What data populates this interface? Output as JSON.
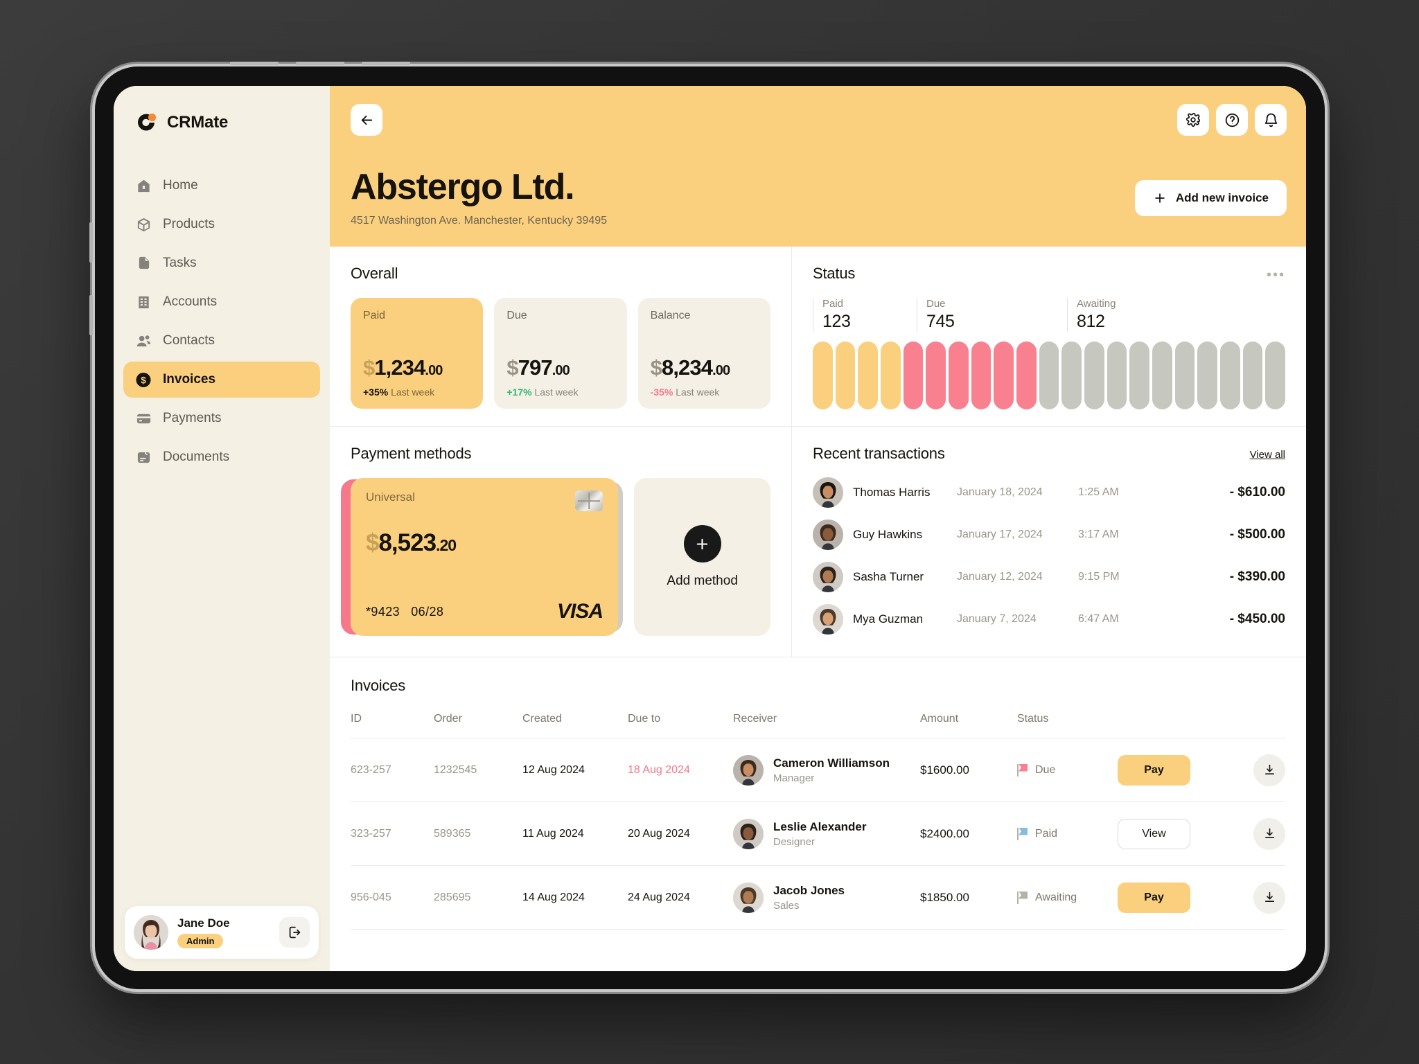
{
  "brand": {
    "name": "CRMate"
  },
  "sidebar": {
    "items": [
      {
        "label": "Home",
        "icon": "home-icon",
        "active": false
      },
      {
        "label": "Products",
        "icon": "box-icon",
        "active": false
      },
      {
        "label": "Tasks",
        "icon": "file-icon",
        "active": false
      },
      {
        "label": "Accounts",
        "icon": "building-icon",
        "active": false
      },
      {
        "label": "Contacts",
        "icon": "users-icon",
        "active": false
      },
      {
        "label": "Invoices",
        "icon": "dollar-circle-icon",
        "active": true
      },
      {
        "label": "Payments",
        "icon": "credit-card-icon",
        "active": false
      },
      {
        "label": "Documents",
        "icon": "document-icon",
        "active": false
      }
    ],
    "user": {
      "name": "Jane Doe",
      "role": "Admin",
      "logout_icon": "logout-icon"
    }
  },
  "header": {
    "back_icon": "arrow-left-icon",
    "settings_icon": "gear-icon",
    "help_icon": "question-circle-icon",
    "notifications_icon": "bell-icon",
    "title": "Abstergo Ltd.",
    "address": "4517 Washington Ave. Manchester, Kentucky 39495",
    "add_invoice_label": "Add new invoice",
    "accent": "#fad07f"
  },
  "overall": {
    "title": "Overall",
    "stats": [
      {
        "label": "Paid",
        "currency": "$",
        "value": "1,234",
        "cents": ".00",
        "delta": "+35%",
        "delta_note": "Last week",
        "trend": "up"
      },
      {
        "label": "Due",
        "currency": "$",
        "value": "797",
        "cents": ".00",
        "delta": "+17%",
        "delta_note": "Last week",
        "trend": "up"
      },
      {
        "label": "Balance",
        "currency": "$",
        "value": "8,234",
        "cents": ".00",
        "delta": "-35%",
        "delta_note": "Last week",
        "trend": "down"
      }
    ]
  },
  "chart_data": {
    "type": "bar",
    "title": "Status",
    "categories": [
      "Paid",
      "Due",
      "Awaiting"
    ],
    "values": [
      123,
      745,
      812
    ],
    "series": [
      {
        "name": "Paid",
        "value": 123,
        "color": "#fad07f",
        "bars": 4
      },
      {
        "name": "Due",
        "value": 745,
        "color": "#f9808f",
        "bars": 6
      },
      {
        "name": "Awaiting",
        "value": 812,
        "color": "#c6c7bf",
        "bars": 11
      }
    ],
    "xlabel": "",
    "ylabel": "",
    "grid": false,
    "legend": "top",
    "menu_icon": "more-horizontal-icon"
  },
  "payment_methods": {
    "title": "Payment methods",
    "card": {
      "label": "Universal",
      "currency": "$",
      "amount": "8,523",
      "cents": ".20",
      "number": "*9423",
      "expiry": "06/28",
      "network": "VISA",
      "chip_icon": "chip-icon"
    },
    "add_method_label": "Add method",
    "add_icon": "plus-icon"
  },
  "transactions": {
    "title": "Recent transactions",
    "view_all_label": "View all",
    "rows": [
      {
        "name": "Thomas Harris",
        "date": "January 18, 2024",
        "time": "1:25 AM",
        "amount": "- $610.00"
      },
      {
        "name": "Guy Hawkins",
        "date": "January 17, 2024",
        "time": "3:17 AM",
        "amount": "- $500.00"
      },
      {
        "name": "Sasha Turner",
        "date": "January 12, 2024",
        "time": "9:15 PM",
        "amount": "- $390.00"
      },
      {
        "name": "Mya Guzman",
        "date": "January 7, 2024",
        "time": "6:47 AM",
        "amount": "- $450.00"
      }
    ]
  },
  "invoices": {
    "title": "Invoices",
    "columns": [
      "ID",
      "Order",
      "Created",
      "Due to",
      "Receiver",
      "Amount",
      "Status"
    ],
    "rows": [
      {
        "id": "623-257",
        "order": "1232545",
        "created": "12 Aug 2024",
        "due": "18 Aug 2024",
        "due_late": true,
        "receiver_name": "Cameron Williamson",
        "receiver_role": "Manager",
        "amount": "$1600.00",
        "status": "Due",
        "status_color": "#f9808f",
        "action": "Pay",
        "action_type": "pay",
        "download_icon": "download-icon"
      },
      {
        "id": "323-257",
        "order": "589365",
        "created": "11 Aug 2024",
        "due": "20 Aug 2024",
        "due_late": false,
        "receiver_name": "Leslie Alexander",
        "receiver_role": "Designer",
        "amount": "$2400.00",
        "status": "Paid",
        "status_color": "#84bde0",
        "action": "View",
        "action_type": "view",
        "download_icon": "download-icon"
      },
      {
        "id": "956-045",
        "order": "285695",
        "created": "14 Aug 2024",
        "due": "24 Aug 2024",
        "due_late": false,
        "receiver_name": "Jacob Jones",
        "receiver_role": "Sales",
        "amount": "$1850.00",
        "status": "Awaiting",
        "status_color": "#b6b2aa",
        "action": "Pay",
        "action_type": "pay",
        "download_icon": "download-icon"
      }
    ]
  }
}
